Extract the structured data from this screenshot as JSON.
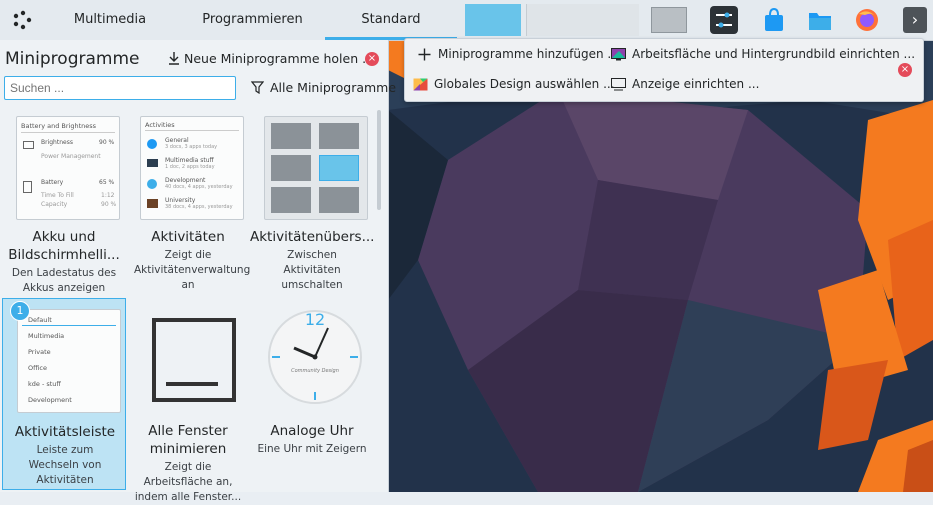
{
  "panel": {
    "tabs": [
      "Multimedia",
      "Programmieren",
      "Standard"
    ],
    "active_tab": "Standard",
    "tray_icons": [
      "system-settings-icon",
      "store-icon",
      "folder-icon",
      "firefox-icon"
    ],
    "expand_glyph": "›"
  },
  "explorer": {
    "title": "Miniprogramme",
    "get_new_label": "Neue Miniprogramme holen ...",
    "search_placeholder": "Suchen ...",
    "filter_label": "Alle Miniprogramme",
    "selected_badge": "1",
    "widgets": [
      {
        "name": "Akku und Bildschirmhelli...",
        "desc": "Den Ladestatus des Akkus anzeigen",
        "preview": {
          "title": "Battery and Brightness",
          "row1_label": "Brightness",
          "row1_value": "90 %",
          "row1_sub": "Power Management",
          "row2_label": "Battery",
          "row2_value": "65 %",
          "row2_sub1": "Time To Fill",
          "row2_sub1_value": "1:12",
          "row2_sub2": "Capacity",
          "row2_sub2_value": "90 %"
        }
      },
      {
        "name": "Aktivitäten",
        "desc": "Zeigt die Aktivitätenverwaltung an",
        "preview": {
          "title": "Activities",
          "items": [
            {
              "label": "General",
              "sub": "3 docs, 3 apps today"
            },
            {
              "label": "Multimedia stuff",
              "sub": "1 doc, 2 apps today"
            },
            {
              "label": "Development",
              "sub": "40 docs, 4 apps, yesterday"
            },
            {
              "label": "University",
              "sub": "38 docs, 4 apps, yesterday"
            }
          ]
        }
      },
      {
        "name": "Aktivitätenübers...",
        "desc": "Zwischen Aktivitäten umschalten"
      },
      {
        "name": "Aktivitätsleiste",
        "desc": "Leiste zum Wechseln von Aktivitäten",
        "preview": {
          "items": [
            "Default",
            "Multimedia",
            "Private",
            "Office",
            "kde - stuff",
            "Development"
          ]
        }
      },
      {
        "name": "Alle Fenster minimieren",
        "desc": "Zeigt die Arbeitsfläche an, indem alle Fenster..."
      },
      {
        "name": "Analoge Uhr",
        "desc": "Eine Uhr mit Zeigern",
        "preview": {
          "twelve": "12",
          "brand": "Community Design"
        }
      }
    ]
  },
  "menu": {
    "items": [
      {
        "label": "Miniprogramme hinzufügen ...",
        "icon": "plus-icon"
      },
      {
        "label": "Arbeitsfläche und Hintergrundbild einrichten ...",
        "icon": "desktop-wallpaper-icon"
      },
      {
        "label": "Globales Design auswählen ...",
        "icon": "global-theme-icon"
      },
      {
        "label": "Anzeige einrichten ...",
        "icon": "display-icon"
      }
    ],
    "close_glyph": "×"
  },
  "colors": {
    "accent": "#3daee9",
    "close": "#e44b5a",
    "desktop_orange": "#f47a1f",
    "desktop_purple": "#4b3a5c"
  }
}
